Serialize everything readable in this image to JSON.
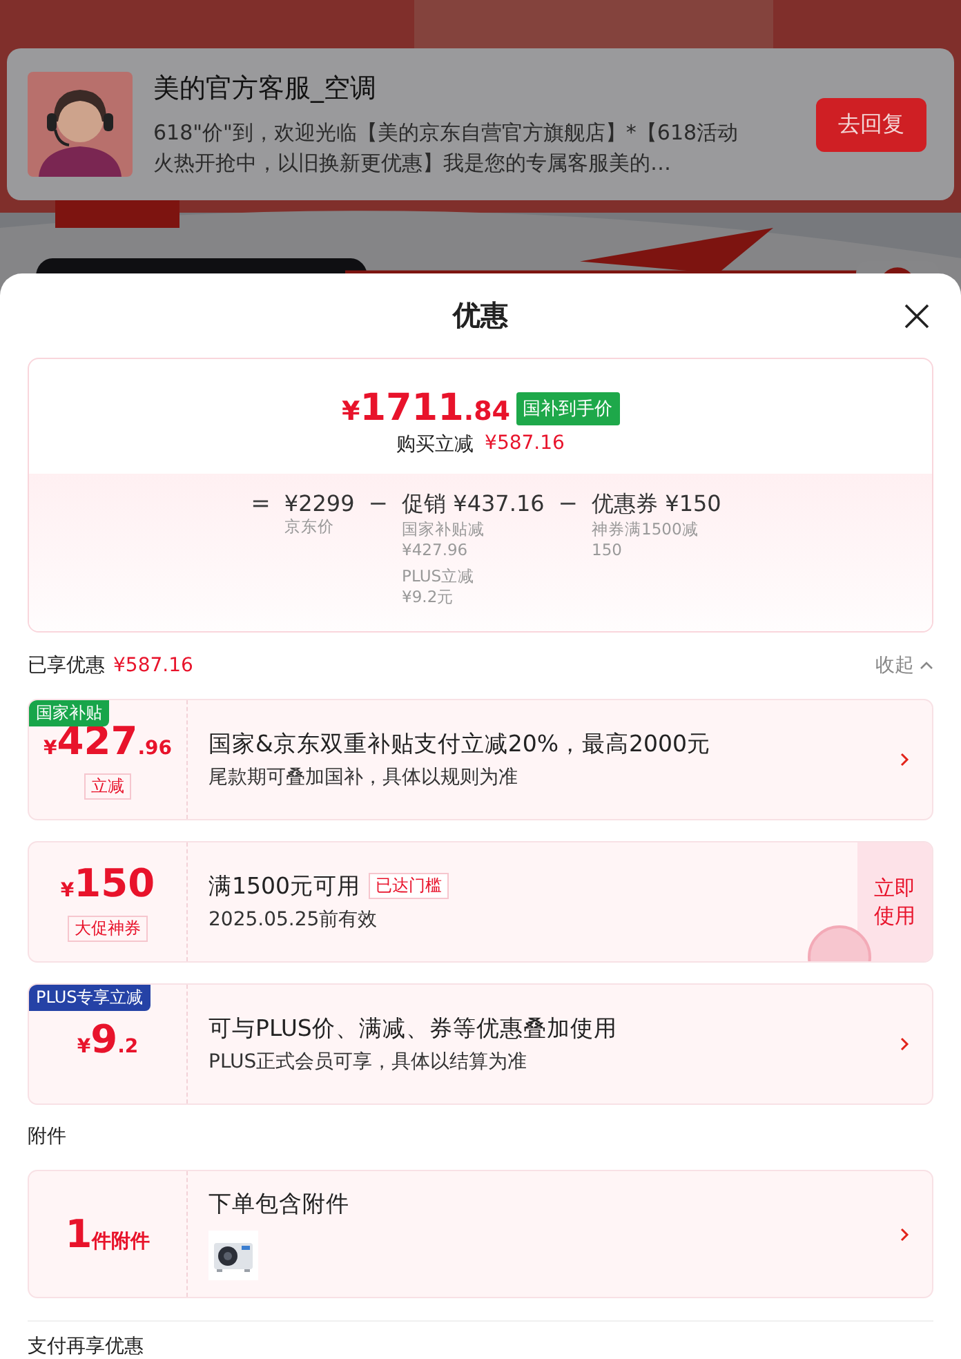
{
  "notification": {
    "sender": "美的官方客服_空调",
    "message": "618\"价\"到，欢迎光临【美的京东自营官方旗舰店】*【618活动火热开抢中，以旧换新更优惠】我是您的专属客服美的…",
    "reply_button": "去回复"
  },
  "sheet": {
    "title": "优惠"
  },
  "price_summary": {
    "symbol": "¥",
    "price_int": "1711",
    "price_dec": ".84",
    "price_tag": "国补到手价",
    "saving_label": "购买立减",
    "saving_amount": "¥587.16",
    "breakdown": [
      {
        "operator": "=",
        "label": "¥2299",
        "notes": [
          [
            "京东价"
          ]
        ]
      },
      {
        "operator": "−",
        "label": "促销 ¥437.16",
        "notes": [
          [
            "国家补贴减",
            "¥427.96"
          ],
          [
            "PLUS立减",
            "¥9.2元"
          ]
        ]
      },
      {
        "operator": "−",
        "label": "优惠券 ¥150",
        "notes": [
          [
            "神券满1500减",
            "150"
          ]
        ]
      }
    ]
  },
  "enjoyed": {
    "label": "已享优惠",
    "amount": "¥587.16",
    "toggle": "收起",
    "expanded": true
  },
  "offer_cards": [
    {
      "kind": "discount",
      "tag": {
        "text": "国家补贴",
        "color": "#18a54a"
      },
      "symbol": "¥",
      "amount_int": "427",
      "amount_dec": ".96",
      "amount_label": "立减",
      "title": "国家&京东双重补贴支付立减20%，最高2000元",
      "subtitle": "尾款期可叠加国补，具体以规则为准"
    },
    {
      "kind": "coupon",
      "symbol": "¥",
      "amount_int": "150",
      "amount_label": "大促神券",
      "title": "满1500元可用",
      "threshold_badge": "已达门槛",
      "subtitle": "2025.05.25前有效",
      "action": "立即使用"
    },
    {
      "kind": "discount",
      "tag": {
        "text": "PLUS专享立减",
        "color": "#2542a6"
      },
      "symbol": "¥",
      "amount_int": "9",
      "amount_dec": ".2",
      "title": "可与PLUS价、满减、券等优惠叠加使用",
      "subtitle": "PLUS正式会员可享，具体以结算为准"
    }
  ],
  "attachments": {
    "heading": "附件",
    "cards": [
      {
        "count": "1",
        "unit": "件附件",
        "title": "下单包含附件"
      }
    ]
  },
  "payment_heading": "支付再享优惠"
}
